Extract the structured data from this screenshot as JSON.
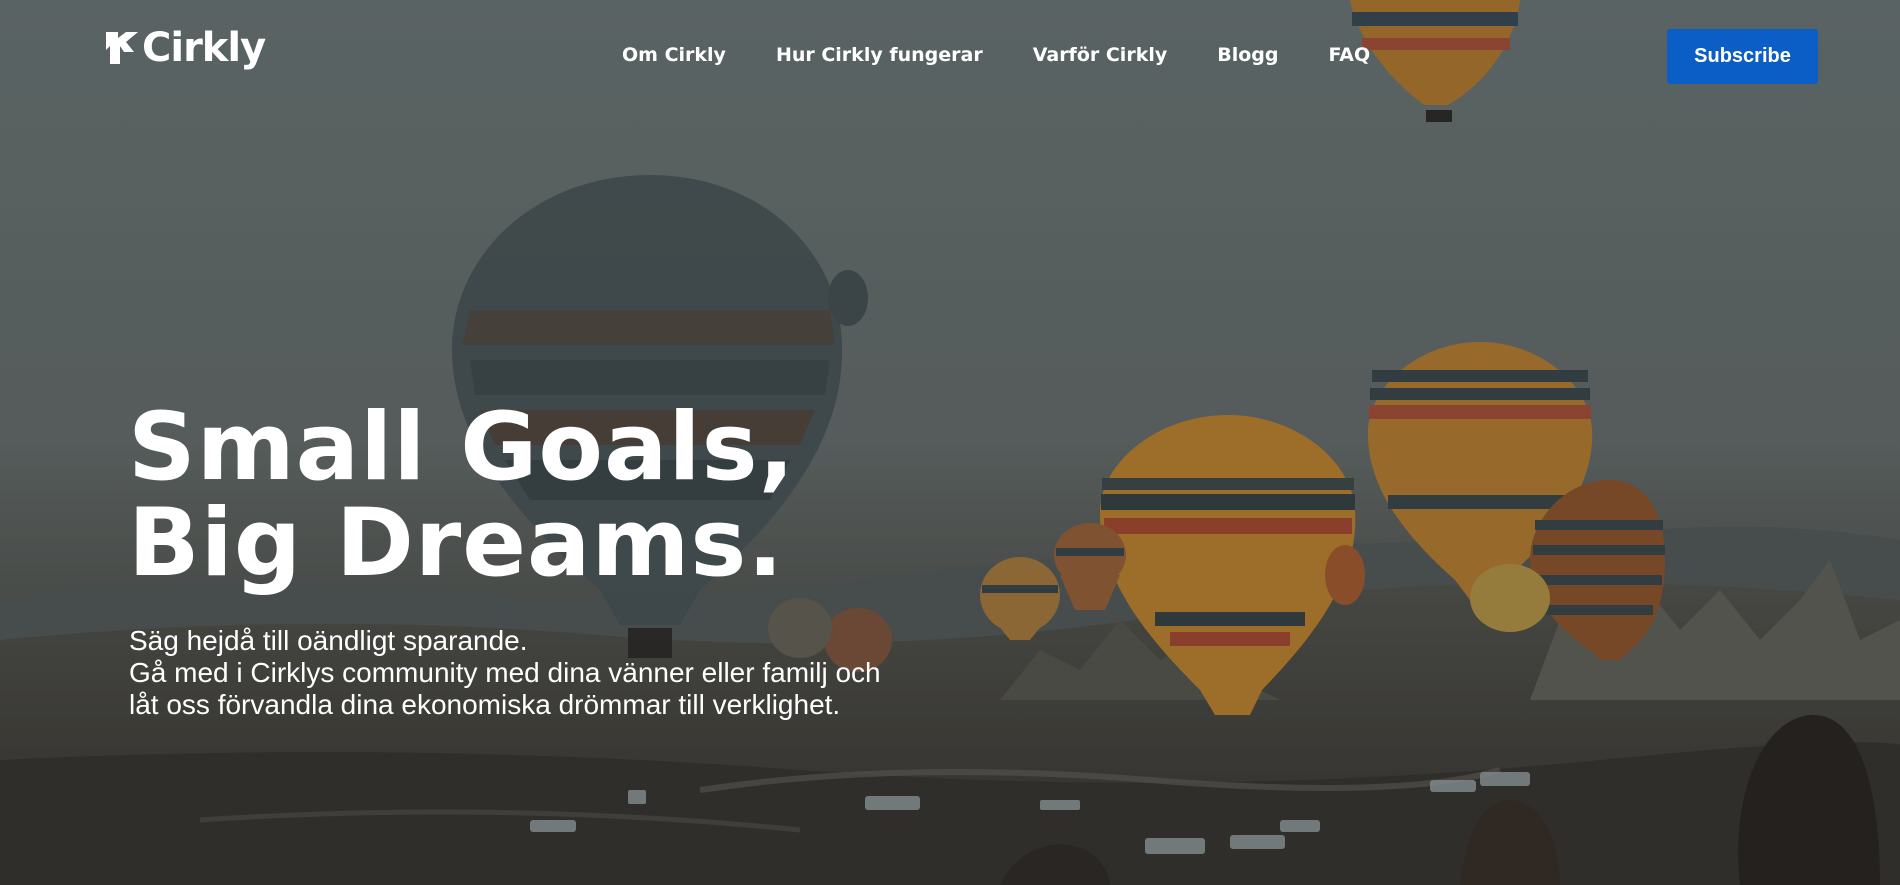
{
  "header": {
    "logo_text": "Cirkly",
    "nav": [
      {
        "label": "Om Cirkly"
      },
      {
        "label": "Hur Cirkly fungerar"
      },
      {
        "label": "Varför Cirkly"
      },
      {
        "label": "Blogg"
      },
      {
        "label": "FAQ"
      }
    ],
    "subscribe_label": "Subscribe"
  },
  "hero": {
    "headline_line1": "Small Goals,",
    "headline_line2": "Big Dreams.",
    "subtext_line1": "Säg hejdå till oändligt sparande.",
    "subtext_line2": "Gå med i Cirklys community med dina vänner eller familj och",
    "subtext_line3": "låt oss förvandla dina ekonomiska drömmar till verklighet."
  },
  "colors": {
    "accent": "#0b5ec6",
    "text": "#ffffff"
  },
  "icons": {
    "logo": "cirkly-logo-mark",
    "background": "hot-air-balloons-photo"
  }
}
